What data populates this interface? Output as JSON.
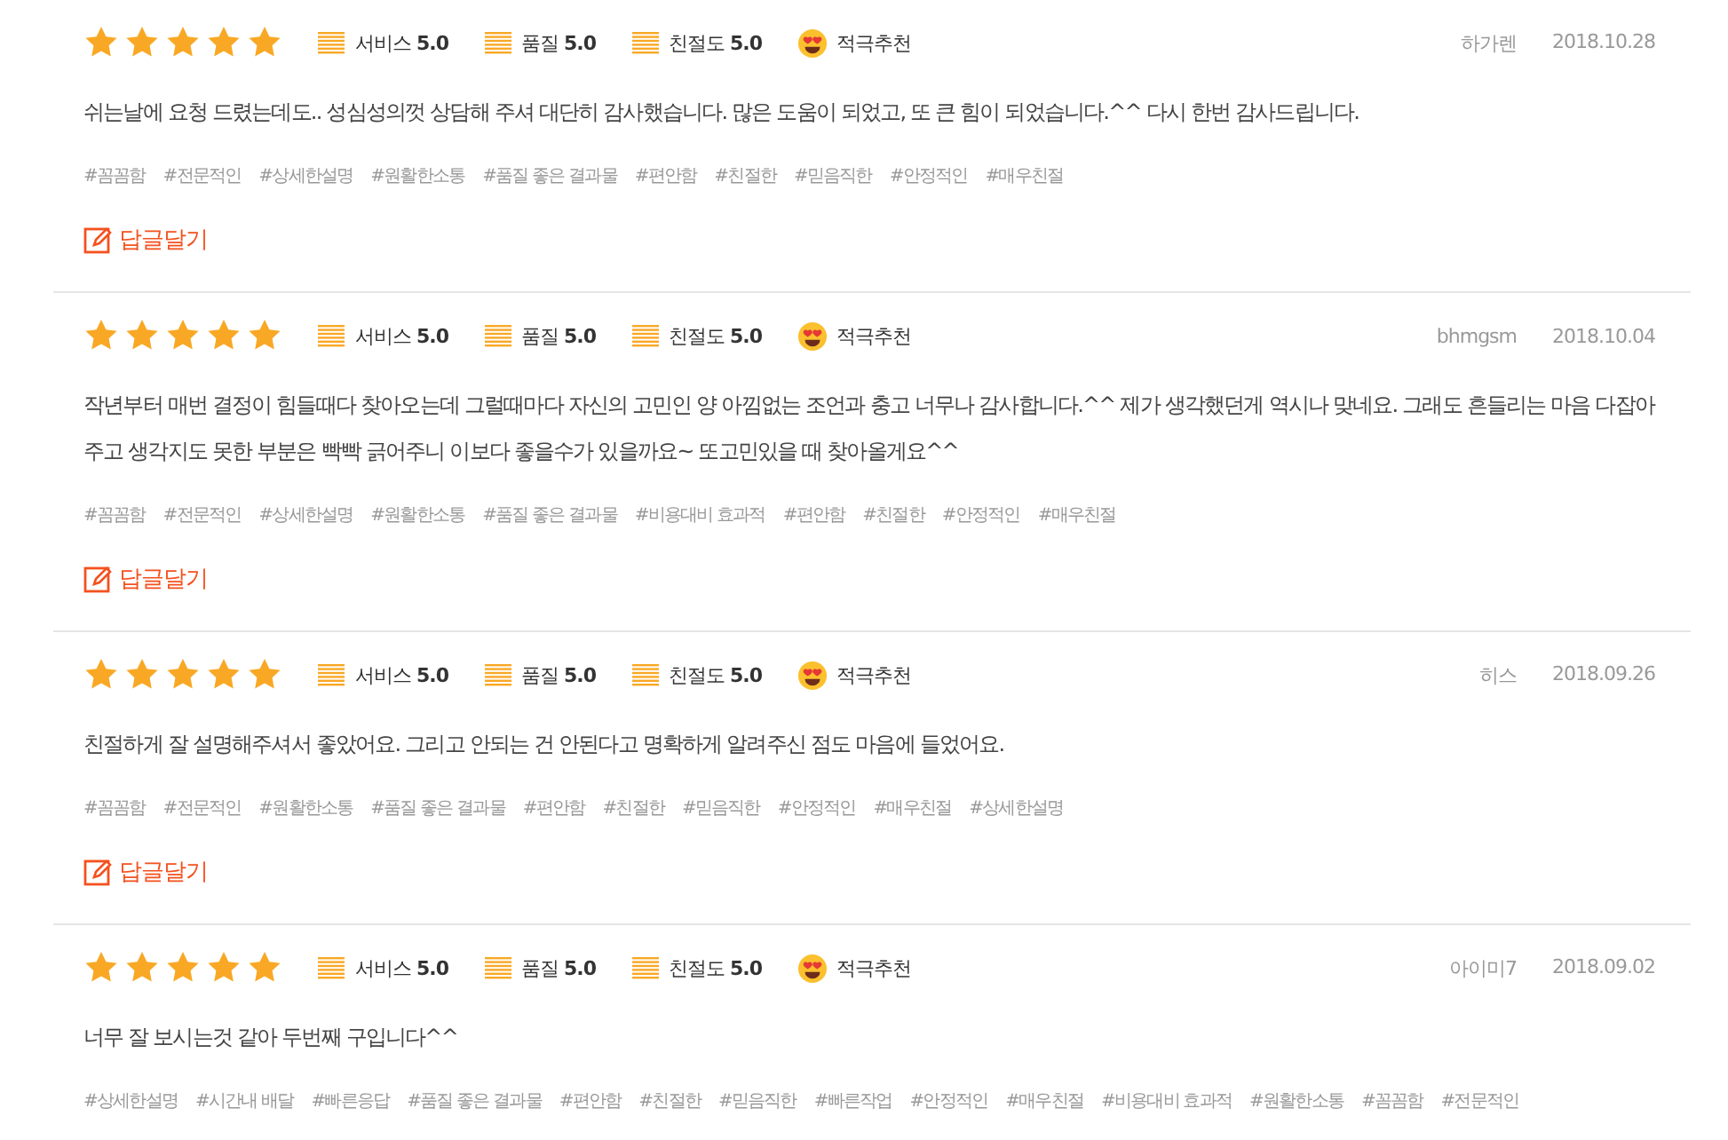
{
  "reviews": [
    {
      "stars": 5,
      "scores": [
        {
          "label": "서비스",
          "value": "5.0"
        },
        {
          "label": "품질",
          "value": "5.0"
        },
        {
          "label": "친절도",
          "value": "5.0"
        }
      ],
      "recommend": "적극추천",
      "author": "하가렌",
      "date": "2018.10.28",
      "text": "쉬는날에 요청 드렸는데도.. 성심성의껏 상담해 주셔 대단히 감사했습니다. 많은 도움이 되었고, 또 큰 힘이 되었습니다.^^ 다시 한번 감사드립니다.",
      "tags": [
        "#꼼꼼함",
        "#전문적인",
        "#상세한설명",
        "#원활한소통",
        "#품질 좋은 결과물",
        "#편안함",
        "#친절한",
        "#믿음직한",
        "#안정적인",
        "#매우친절"
      ],
      "reply": "답글달기"
    },
    {
      "stars": 5,
      "scores": [
        {
          "label": "서비스",
          "value": "5.0"
        },
        {
          "label": "품질",
          "value": "5.0"
        },
        {
          "label": "친절도",
          "value": "5.0"
        }
      ],
      "recommend": "적극추천",
      "author": "bhmgsm",
      "date": "2018.10.04",
      "text": "작년부터 매번 결정이 힘들때다 찾아오는데 그럴때마다 자신의 고민인 양 아낌없는 조언과 충고 너무나 감사합니다.^^ 제가 생각했던게 역시나 맞네요. 그래도 흔들리는 마음 다잡아 주고 생각지도 못한 부분은 빡빡 긁어주니 이보다 좋을수가 있을까요~ 또고민있을 때 찾아올게요^^",
      "tags": [
        "#꼼꼼함",
        "#전문적인",
        "#상세한설명",
        "#원활한소통",
        "#품질 좋은 결과물",
        "#비용대비 효과적",
        "#편안함",
        "#친절한",
        "#안정적인",
        "#매우친절"
      ],
      "reply": "답글달기"
    },
    {
      "stars": 5,
      "scores": [
        {
          "label": "서비스",
          "value": "5.0"
        },
        {
          "label": "품질",
          "value": "5.0"
        },
        {
          "label": "친절도",
          "value": "5.0"
        }
      ],
      "recommend": "적극추천",
      "author": "히스",
      "date": "2018.09.26",
      "text": "친절하게 잘 설명해주셔서 좋았어요. 그리고 안되는 건 안된다고 명확하게 알려주신 점도 마음에 들었어요.",
      "tags": [
        "#꼼꼼함",
        "#전문적인",
        "#원활한소통",
        "#품질 좋은 결과물",
        "#편안함",
        "#친절한",
        "#믿음직한",
        "#안정적인",
        "#매우친절",
        "#상세한설명"
      ],
      "reply": "답글달기"
    },
    {
      "stars": 5,
      "scores": [
        {
          "label": "서비스",
          "value": "5.0"
        },
        {
          "label": "품질",
          "value": "5.0"
        },
        {
          "label": "친절도",
          "value": "5.0"
        }
      ],
      "recommend": "적극추천",
      "author": "아이미7",
      "date": "2018.09.02",
      "text": "너무 잘 보시는것 같아 두번째 구입니다^^",
      "tags": [
        "#상세한설명",
        "#시간내 배달",
        "#빠른응답",
        "#품질 좋은 결과물",
        "#편안함",
        "#친절한",
        "#믿음직한",
        "#빠른작업",
        "#안정적인",
        "#매우친절",
        "#비용대비 효과적",
        "#원활한소통",
        "#꼼꼼함",
        "#전문적인"
      ]
    }
  ]
}
